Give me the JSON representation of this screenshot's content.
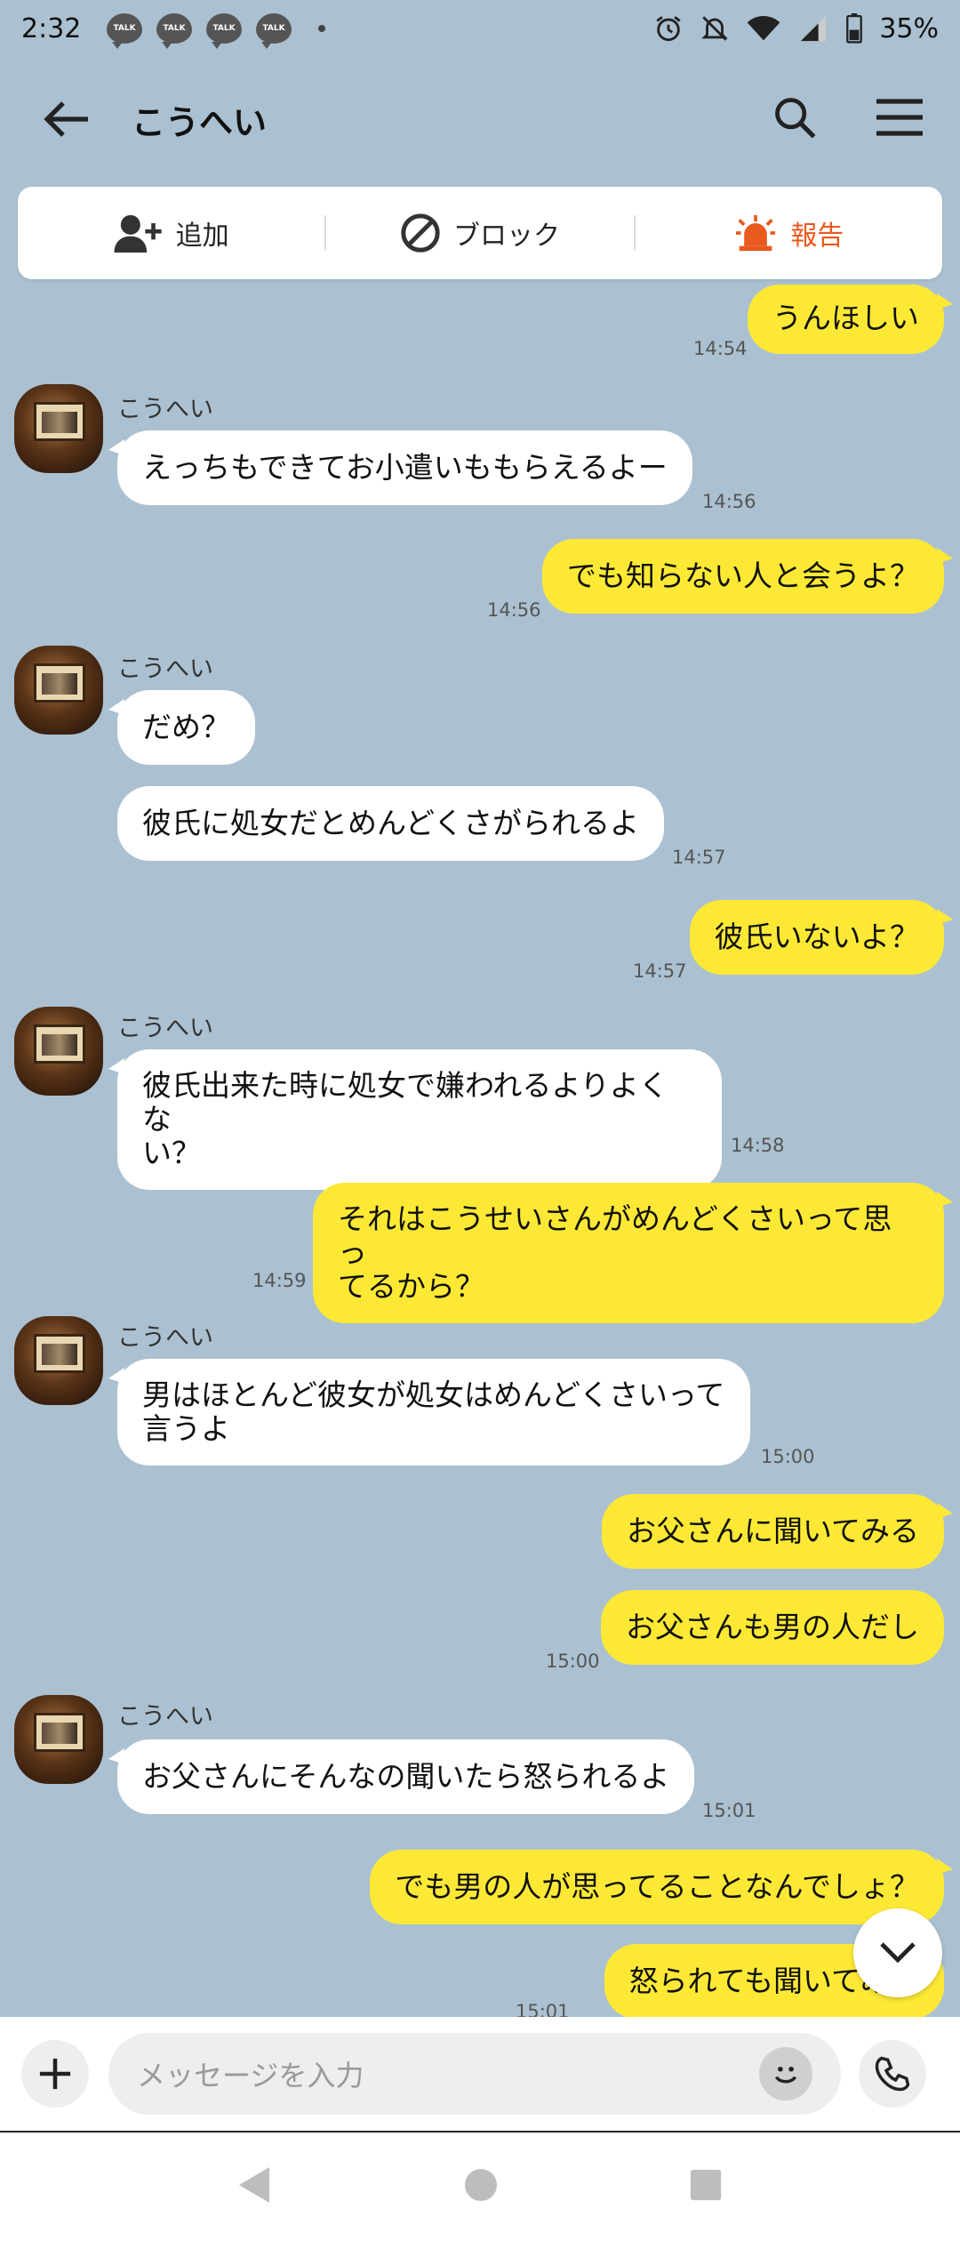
{
  "status_bar": {
    "time": "2:32",
    "notification_label": "TALK",
    "battery": "35%"
  },
  "header": {
    "title": "こうへい"
  },
  "action_bar": {
    "add_label": "追加",
    "block_label": "ブロック",
    "report_label": "報告"
  },
  "messages": [
    {
      "dir": "out",
      "text": "うんほしい",
      "time": "14:54"
    },
    {
      "dir": "in",
      "sender": "こうへい",
      "text": "えっちもできてお小遣いももらえるよー",
      "time": "14:56"
    },
    {
      "dir": "out",
      "text": "でも知らない人と会うよ？",
      "time": "14:56"
    },
    {
      "dir": "in",
      "sender": "こうへい",
      "text": "だめ？",
      "time": ""
    },
    {
      "dir": "in",
      "text": "彼氏に処女だとめんどくさがられるよ",
      "time": "14:57"
    },
    {
      "dir": "out",
      "text": "彼氏いないよ？",
      "time": "14:57"
    },
    {
      "dir": "in",
      "sender": "こうへい",
      "line1": "彼氏出来た時に処女で嫌われるよりよくな",
      "line2": "い？",
      "time": "14:58"
    },
    {
      "dir": "out",
      "line1": "それはこうせいさんがめんどくさいって思っ",
      "line2": "てるから？",
      "time": "14:59"
    },
    {
      "dir": "in",
      "sender": "こうへい",
      "line1": "男はほとんど彼女が処女はめんどくさいって",
      "line2": "言うよ",
      "time": "15:00"
    },
    {
      "dir": "out",
      "text": "お父さんに聞いてみる",
      "time": ""
    },
    {
      "dir": "out",
      "text": "お父さんも男の人だし",
      "time": "15:00"
    },
    {
      "dir": "in",
      "sender": "こうへい",
      "text": "お父さんにそんなの聞いたら怒られるよ",
      "time": "15:01"
    },
    {
      "dir": "out",
      "text": "でも男の人が思ってることなんでしょ？",
      "time": ""
    },
    {
      "dir": "out",
      "text": "怒られても聞いてみた",
      "time": "15:01"
    }
  ],
  "input": {
    "placeholder": "メッセージを入力"
  },
  "icons": {
    "back": "arrow-left-icon",
    "search": "search-icon",
    "menu": "hamburger-menu-icon",
    "add_friend": "add-person-icon",
    "block": "block-icon",
    "report": "siren-icon",
    "scroll_down": "chevron-down-icon",
    "plus": "plus-icon",
    "emoji": "emoji-icon",
    "call": "phone-icon"
  },
  "colors": {
    "background": "#abc1d1",
    "outgoing_bubble": "#fde935",
    "incoming_bubble": "#ffffff",
    "report_accent": "#e85a1e"
  }
}
